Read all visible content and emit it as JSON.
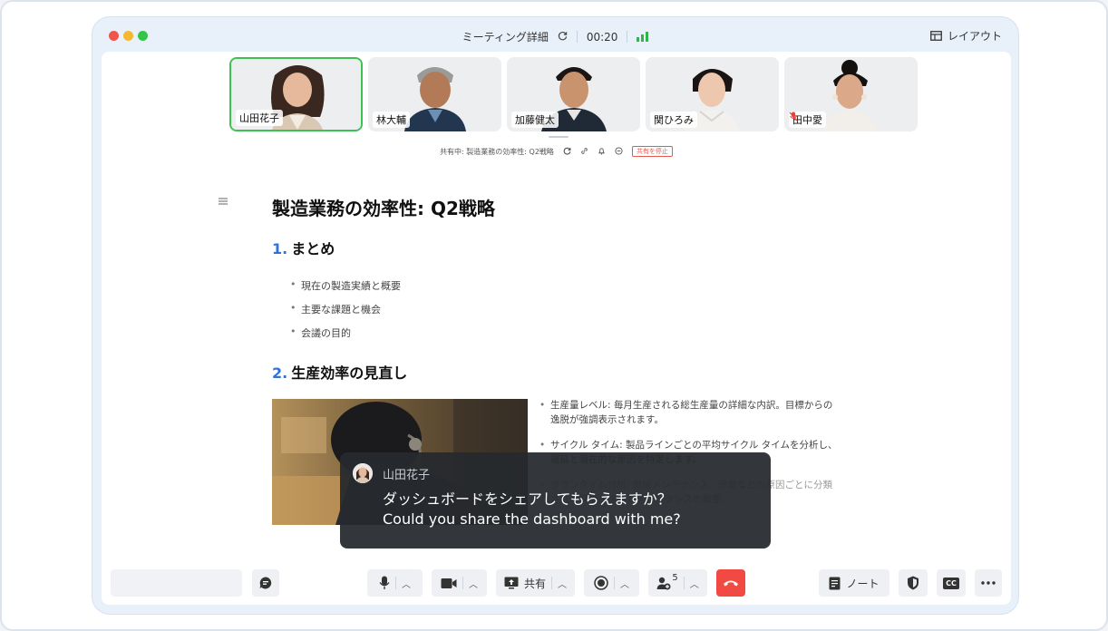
{
  "window": {
    "title": "ミーティング詳細",
    "timer": "00:20",
    "layout_label": "レイアウト"
  },
  "participants": [
    {
      "name": "山田花子",
      "active": true,
      "muted": false
    },
    {
      "name": "林大輔",
      "active": false,
      "muted": false
    },
    {
      "name": "加藤健太",
      "active": false,
      "muted": false
    },
    {
      "name": "関ひろみ",
      "active": false,
      "muted": false
    },
    {
      "name": "田中愛",
      "active": false,
      "muted": true
    }
  ],
  "share_bar": {
    "text": "共有中: 製造業務の効率性: Q2戦略",
    "stop_label": "共有を停止"
  },
  "document": {
    "title": "製造業務の効率性: Q2戦略",
    "sections": [
      {
        "number": "1.",
        "heading": "まとめ",
        "items": [
          "現在の製造実績と概要",
          "主要な課題と機会",
          "会議の目的"
        ]
      },
      {
        "number": "2.",
        "heading": "生産効率の見直し",
        "items": [
          "生産量レベル: 毎月生産される総生産量の詳細な内訳。目標からの逸脱が強調表示されます。",
          "サイクル タイム: 製品ラインごとの平均サイクル タイムを分析し、遅延と潜在的な原因を特定します。",
          "ダウンタイム分析: 機械メンテナンス、停電などの原因ごとに分類されたダウンタイムインスタンスの概要。"
        ]
      }
    ]
  },
  "caption": {
    "speaker": "山田花子",
    "text_jp": "ダッシュボードをシェアしてもらえますか？",
    "text_en": "Could you share the dashboard with me?"
  },
  "toolbar": {
    "share_label": "共有",
    "participants_count": "5",
    "notes_label": "ノート",
    "cc_label": "CC"
  },
  "colors": {
    "active_border": "#3cc155",
    "accent_blue": "#2f73d9",
    "end_call": "#f04a43"
  }
}
